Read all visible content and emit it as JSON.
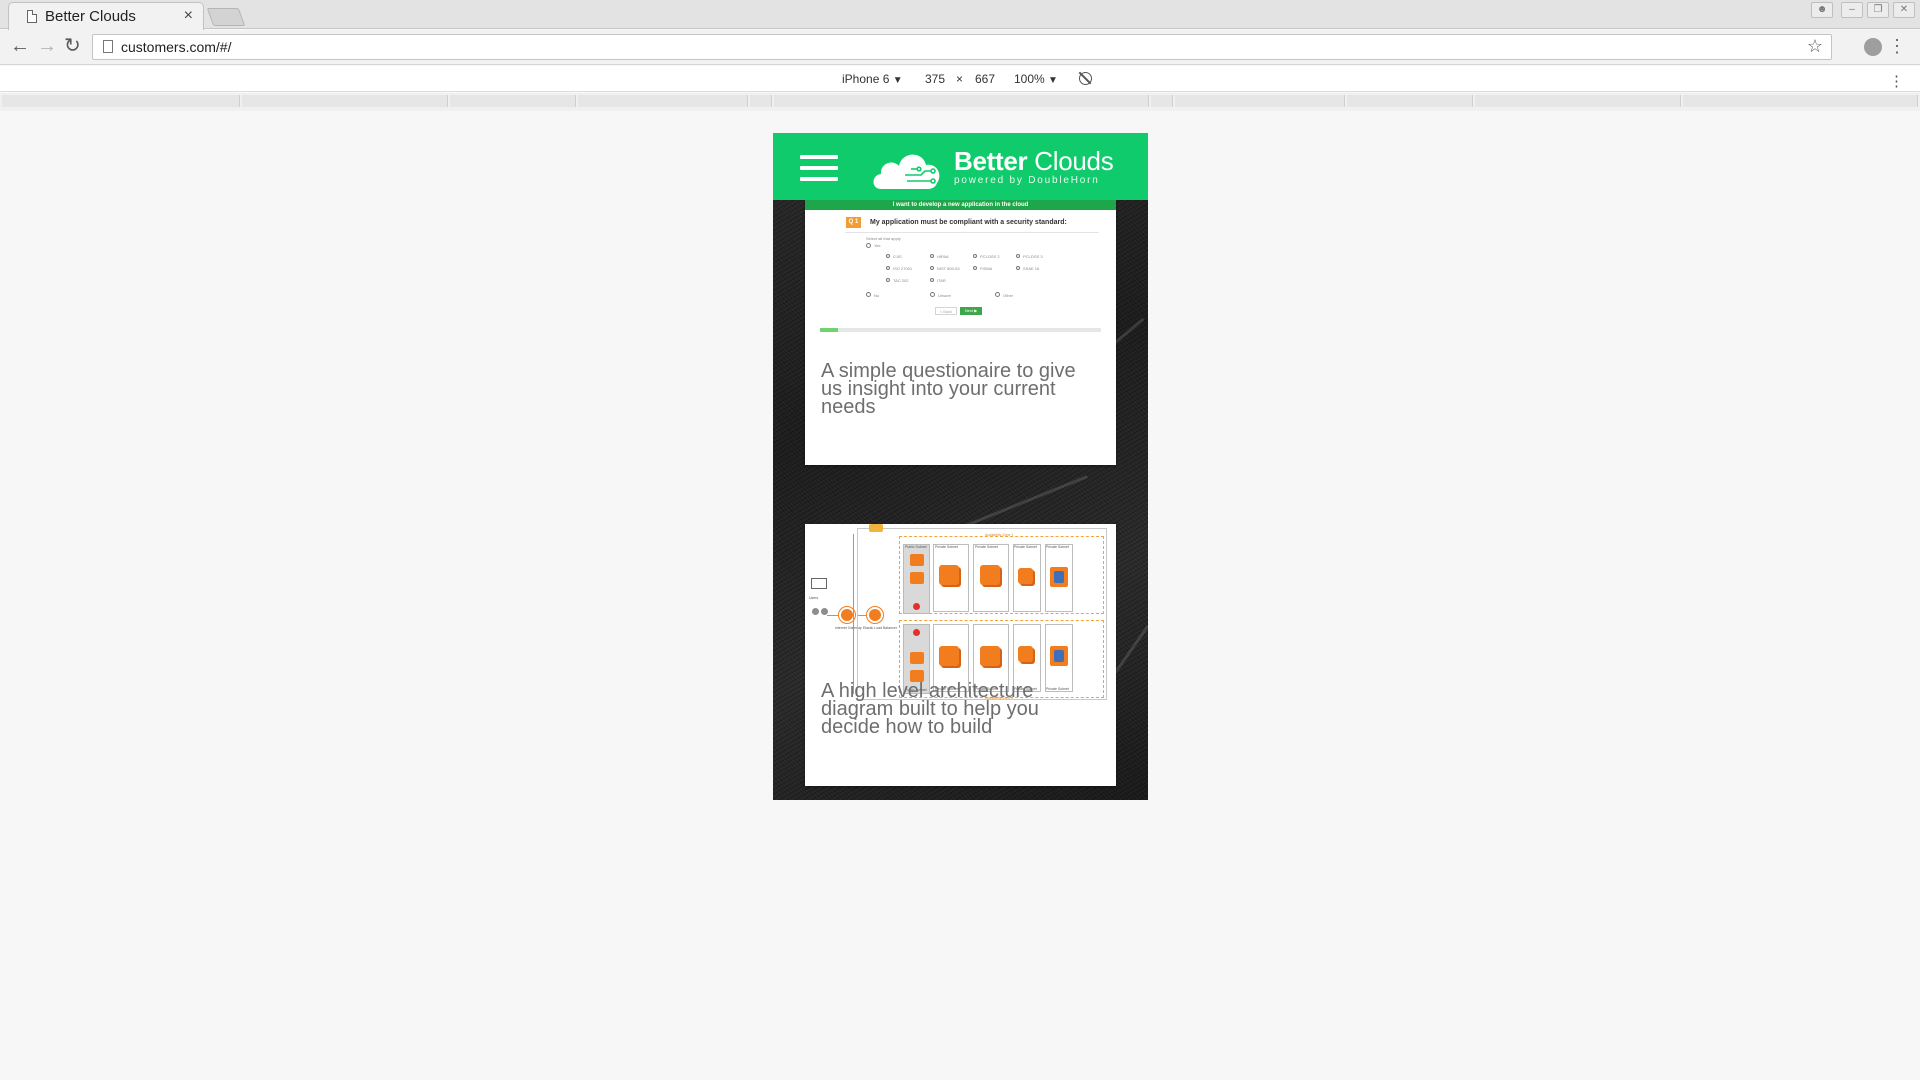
{
  "browser": {
    "tab_title": "Better Clouds",
    "tab_close": "×",
    "url": "customers.com/#/",
    "icons": {
      "back": "back-arrow-icon",
      "forward": "forward-arrow-icon",
      "reload": "reload-icon",
      "bookmark": "star-icon",
      "menu": "vertical-dots-icon"
    }
  },
  "device_toolbar": {
    "device": "iPhone 6",
    "width": "375",
    "times": "×",
    "height": "667",
    "zoom": "100%",
    "caret": "▼"
  },
  "app": {
    "brand_bold": "Better",
    "brand_light": "Clouds",
    "brand_tagline": "powered by DoubleHorn",
    "header_color": "#10cb6c"
  },
  "cards": [
    {
      "caption": "A simple questionaire to give us insight into your current needs",
      "screenshot": {
        "banner": "I want to develop a new application in the cloud",
        "question_number": "Q 1",
        "question": "My application must be compliant with a security standard:",
        "hint": "Select all that apply",
        "yes": "Yes",
        "standards": [
          "CJIS",
          "HIPAA",
          "PCI-DSS 2",
          "PCI-DSS 3",
          "ISO 27001",
          "NIST 800-53",
          "FISMA",
          "SSAE 16",
          "TAC 202",
          "ITAR"
        ],
        "answers": [
          "No",
          "Unsure",
          "Other"
        ],
        "back_label": "< Back",
        "next_label": "Next ▶",
        "steps": [
          "1",
          "2",
          "3",
          "4",
          "5",
          "6",
          "7",
          "8",
          "9",
          "10",
          "11",
          "12",
          "13",
          "14"
        ]
      }
    },
    {
      "caption": "A high level architecture diagram built to help you decide how to build",
      "screenshot": {
        "az1": "Availability Zone 1",
        "az2": "Availability Zone 2",
        "public_subnet": "Public Subnet",
        "private_subnet": "Private Subnet",
        "users": "Users",
        "internet_gateway": "Internet Gateway",
        "elb": "Elastic Load Balancer"
      }
    }
  ]
}
